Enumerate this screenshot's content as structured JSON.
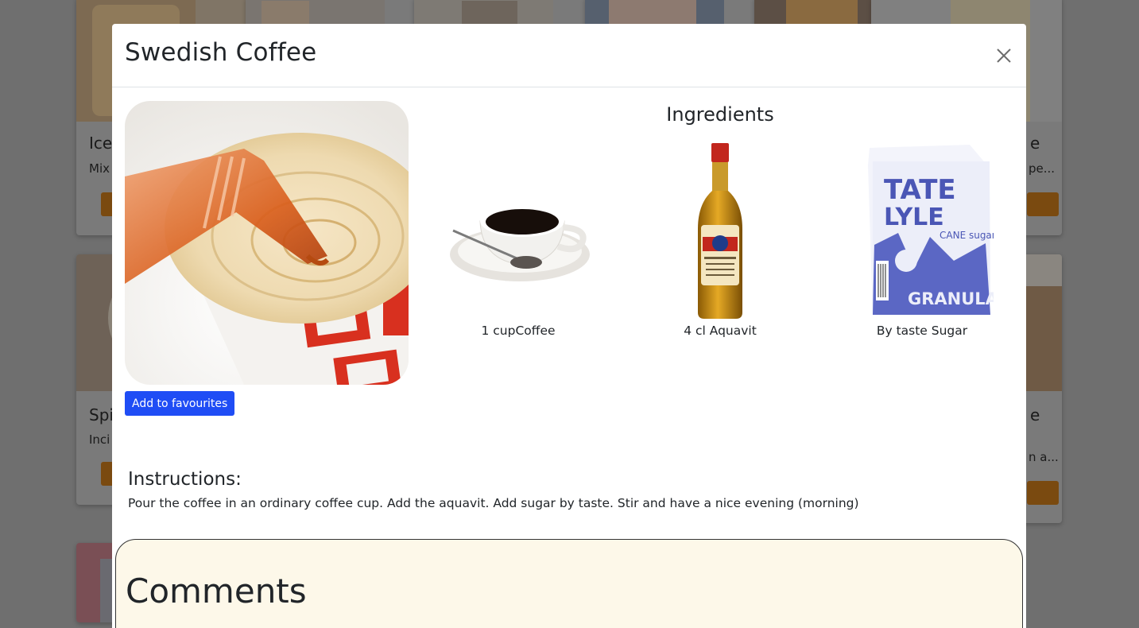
{
  "background_cards": [
    {
      "title": "Ice",
      "text": "Mix"
    },
    {
      "title": "",
      "text": ""
    },
    {
      "title": "",
      "text": ""
    },
    {
      "title": "",
      "text": ""
    },
    {
      "title": "",
      "text": ""
    },
    {
      "title": "e",
      "text": "pe..."
    },
    {
      "title": "Spi",
      "text": "Inci"
    },
    {
      "title": "e",
      "text": "n a..."
    }
  ],
  "modal": {
    "title": "Swedish Coffee",
    "add_favourites_label": "Add to favourites",
    "ingredients_heading": "Ingredients",
    "ingredients": [
      {
        "label": "1 cupCoffee",
        "icon": "coffee-cup-image"
      },
      {
        "label": "4 cl Aquavit",
        "icon": "aquavit-bottle-image"
      },
      {
        "label": "By taste Sugar",
        "icon": "sugar-bag-image"
      }
    ],
    "instructions_heading": "Instructions:",
    "instructions_text": "Pour the coffee in an ordinary coffee cup. Add the aquavit. Add sugar by taste. Stir and have a nice evening (morning)",
    "comments_heading": "Comments"
  },
  "colors": {
    "backdrop": "#6f6f6f",
    "favourite_button": "#1f4df5",
    "comments_background": "#fdf8e9",
    "background_card_button": "#7a4a10"
  }
}
